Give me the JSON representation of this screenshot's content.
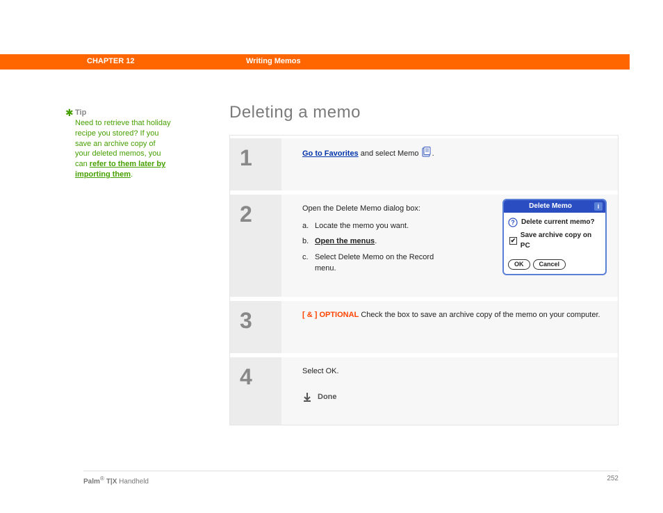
{
  "header": {
    "chapter": "CHAPTER 12",
    "section": "Writing Memos"
  },
  "tip": {
    "label": "Tip",
    "text": "Need to retrieve that holiday recipe you stored? If you save an archive copy of your deleted memos, you can ",
    "link": "refer to them later by importing them",
    "after": "."
  },
  "title": "Deleting a memo",
  "steps": {
    "s1": {
      "num": "1",
      "link": "Go to Favorites",
      "rest": " and select Memo ",
      "period": "."
    },
    "s2": {
      "num": "2",
      "intro": "Open the Delete Memo dialog box:",
      "a": "Locate the memo you want.",
      "b_link": "Open the menus",
      "b_after": ".",
      "c": "Select Delete Memo on the Record menu."
    },
    "s3": {
      "num": "3",
      "tag": "[ & ]  OPTIONAL",
      "body": "   Check the box to save an archive copy of the memo on your computer."
    },
    "s4": {
      "num": "4",
      "body": "Select OK.",
      "done": "Done"
    }
  },
  "dialog": {
    "title": "Delete Memo",
    "q": "Delete current memo?",
    "chk_label": "Save archive copy on PC",
    "ok": "OK",
    "cancel": "Cancel"
  },
  "footer": {
    "product_bold": "Palm",
    "product_reg": "®",
    "product_model": " T|X",
    "product_rest": " Handheld",
    "page": "252"
  }
}
